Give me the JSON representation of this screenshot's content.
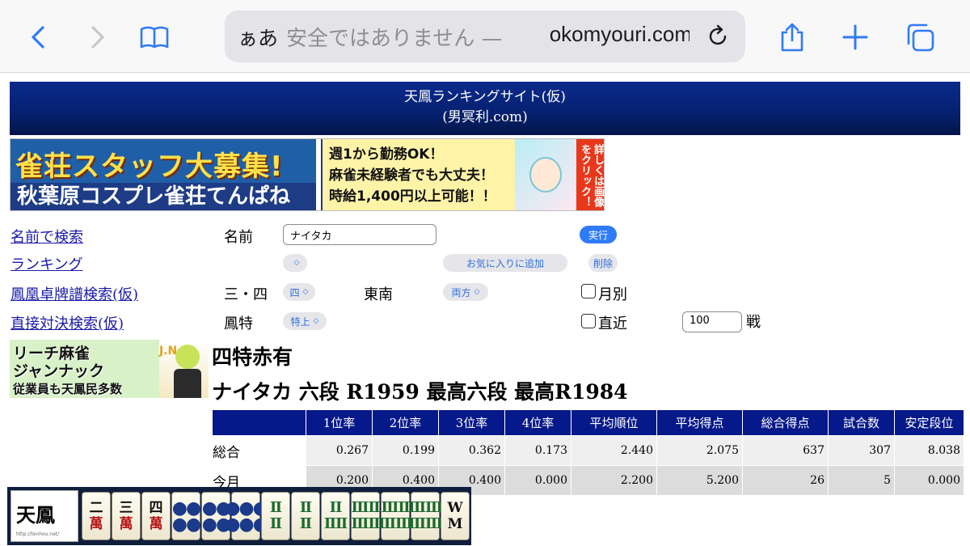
{
  "browser": {
    "aa_label": "ぁあ",
    "insecure_label": "安全ではありません —",
    "domain": "okomyouri.com",
    "icons": [
      "back-chevron-icon",
      "forward-chevron-icon",
      "bookmarks-book-icon",
      "reload-icon",
      "share-icon",
      "plus-icon",
      "tabs-icon"
    ]
  },
  "site": {
    "title": "天鳳ランキングサイト(仮)",
    "subtitle": "(男冥利.com)"
  },
  "ad_banner": {
    "headline": "雀荘スタッフ大募集!",
    "shop": "秋葉原コスプレ雀荘てんぱね",
    "lines": [
      "週1から勤務OK！",
      "麻雀未経験者でも大丈夫！",
      "時給1,400円以上可能！！"
    ],
    "side": "詳しくは画像をクリック！"
  },
  "nav_links": {
    "name_search": "名前で検索",
    "ranking": "ランキング",
    "houou_search": "鳳凰卓牌譜検索(仮)",
    "direct_search": "直接対決検索(仮)"
  },
  "form": {
    "name_label": "名前",
    "name_value": "ナイタカ",
    "execute": "実行",
    "favorite": "お気に入りに追加",
    "delete": "削除",
    "players_label": "三・四",
    "players_value": "四",
    "length_label": "東南",
    "length_value": "両方",
    "monthly_label": "月別",
    "room_label": "鳳特",
    "room_value": "特上",
    "recent_label": "直近",
    "recent_value": "100",
    "games_unit": "戦"
  },
  "jannak_banner": {
    "line1": "リーチ麻雀",
    "line2": "ジャンナック",
    "line3": "従業員も天鳳民多数",
    "jn": "J.N"
  },
  "result": {
    "rule": "四特赤有",
    "player": "ナイタカ 六段 R1959 最高六段 最高R1984"
  },
  "stats_table": {
    "headers": [
      "",
      "1位率",
      "2位率",
      "3位率",
      "4位率",
      "平均順位",
      "平均得点",
      "総合得点",
      "試合数",
      "安定段位"
    ],
    "rows": [
      [
        "総合",
        "0.267",
        "0.199",
        "0.362",
        "0.173",
        "2.440",
        "2.075",
        "637",
        "307",
        "8.038"
      ],
      [
        "今月",
        "0.200",
        "0.400",
        "0.400",
        "0.000",
        "2.200",
        "5.200",
        "26",
        "5",
        "0.000"
      ]
    ]
  },
  "tenhou_banner": {
    "logo": "天鳳",
    "url": "http://tenhou.net/",
    "tiles": [
      {
        "top": "二",
        "bottom": "萬",
        "kind": "m"
      },
      {
        "top": "三",
        "bottom": "萬",
        "kind": "m"
      },
      {
        "top": "四",
        "bottom": "萬",
        "kind": "m"
      },
      {
        "top": "●●",
        "bottom": "●●",
        "kind": "p"
      },
      {
        "top": "●●",
        "bottom": "●●",
        "kind": "p"
      },
      {
        "top": "●●●",
        "bottom": "●●●",
        "kind": "p"
      },
      {
        "top": "Ⅱ",
        "bottom": "Ⅱ",
        "kind": "s"
      },
      {
        "top": "Ⅱ",
        "bottom": "Ⅱ",
        "kind": "s"
      },
      {
        "top": "ⅠⅠ",
        "bottom": "ⅡⅡ",
        "kind": "s"
      },
      {
        "top": "ⅢⅡ",
        "bottom": "ⅢⅡ",
        "kind": "s"
      },
      {
        "top": "ⅢⅡ",
        "bottom": "ⅢⅢ",
        "kind": "s"
      },
      {
        "top": "ⅢⅢ",
        "bottom": "ⅢⅢ",
        "kind": "s"
      },
      {
        "top": "W",
        "bottom": "M",
        "kind": "k"
      }
    ]
  }
}
